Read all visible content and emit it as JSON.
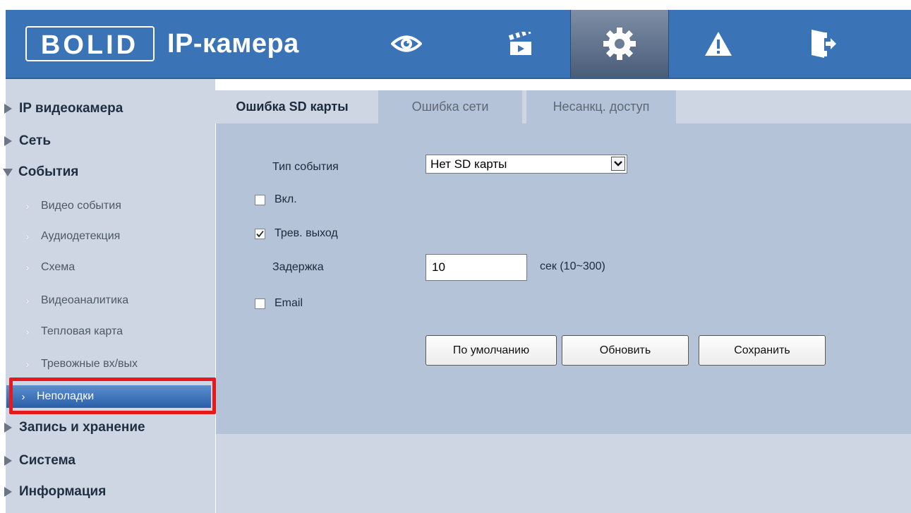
{
  "header": {
    "logo_text": "BOLID",
    "app_title": "IP-камера",
    "nav": [
      {
        "name": "live-view",
        "icon": "eye-icon"
      },
      {
        "name": "playback",
        "icon": "clapperboard-icon"
      },
      {
        "name": "settings",
        "icon": "gear-icon",
        "active": true
      },
      {
        "name": "alarm",
        "icon": "warning-icon"
      },
      {
        "name": "logout",
        "icon": "exit-icon"
      }
    ]
  },
  "sidebar": {
    "groups": [
      {
        "label": "IP видеокамера",
        "expanded": false
      },
      {
        "label": "Сеть",
        "expanded": false
      },
      {
        "label": "События",
        "expanded": true
      },
      {
        "label": "Запись и хранение",
        "expanded": false
      },
      {
        "label": "Система",
        "expanded": false
      },
      {
        "label": "Информация",
        "expanded": false
      }
    ],
    "events_items": [
      {
        "label": "Видео события"
      },
      {
        "label": "Аудиодетекция"
      },
      {
        "label": "Схема"
      },
      {
        "label": "Видеоаналитика"
      },
      {
        "label": "Тепловая карта"
      },
      {
        "label": "Тревожные вх/вых"
      },
      {
        "label": "Неполадки",
        "selected": true
      }
    ]
  },
  "tabs": [
    {
      "label": "Ошибка SD карты",
      "active": true
    },
    {
      "label": "Ошибка сети",
      "active": false
    },
    {
      "label": "Несанкц. доступ",
      "active": false
    }
  ],
  "form": {
    "event_type_label": "Тип события",
    "event_type_value": "Нет SD карты",
    "enable_label": "Вкл.",
    "enable_checked": false,
    "alarm_out_label": "Трев. выход",
    "alarm_out_checked": true,
    "delay_label": "Задержка",
    "delay_value": "10",
    "delay_hint": "сек (10~300)",
    "email_label": "Email",
    "email_checked": false
  },
  "buttons": {
    "default_label": "По умолчанию",
    "refresh_label": "Обновить",
    "save_label": "Сохранить"
  },
  "colors": {
    "header_blue": "#3b74b6",
    "sidebar_bg": "#cdd6e2",
    "panel_bg": "#b4c3d7",
    "selected_item": "#2a5fa8",
    "highlight_red": "#e8191c"
  }
}
